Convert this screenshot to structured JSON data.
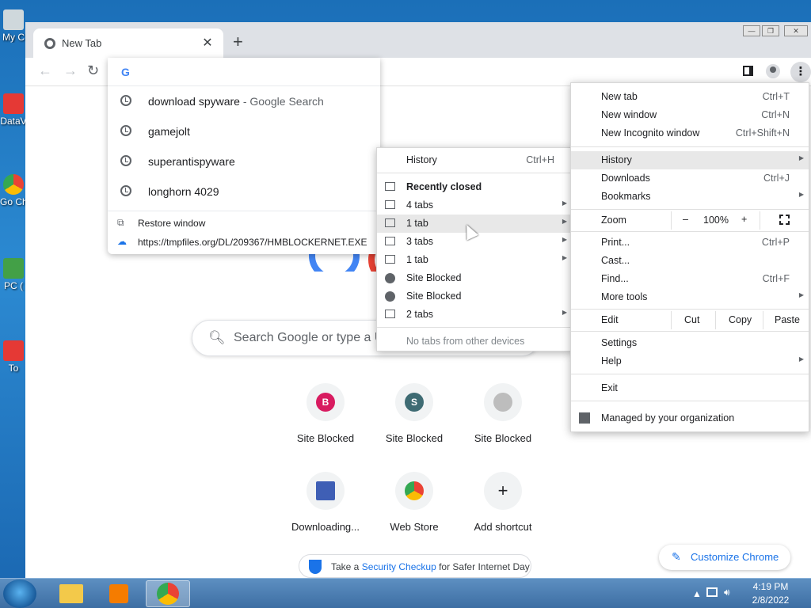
{
  "desktop": {
    "icons": [
      "My C",
      "DataV",
      "Go Ch",
      "PC (",
      "To"
    ]
  },
  "window": {
    "tab_title": "New Tab",
    "tab_close": "✕",
    "new_tab": "+",
    "minimize": "—",
    "maximize": "❐",
    "close": "✕"
  },
  "toolbar": {
    "back": "←",
    "forward": "→",
    "reload": "↻",
    "omnibox_value": ""
  },
  "omnibox": {
    "google_g": "G",
    "suggestions": [
      {
        "text": "download spyware",
        "desc": " - Google Search"
      },
      {
        "text": "gamejolt",
        "desc": ""
      },
      {
        "text": "superantispyware",
        "desc": ""
      },
      {
        "text": "longhorn 4029",
        "desc": ""
      }
    ],
    "restore_window": "Restore window",
    "download_url": "https://tmpfiles.org/DL/209367/HMBLOCKERNET.EXE"
  },
  "ntp": {
    "search_placeholder": "Search Google or type a U",
    "tiles": [
      {
        "label": "Site Blocked",
        "letter": "B",
        "color": "#d81b60"
      },
      {
        "label": "Site Blocked",
        "letter": "S",
        "color": "#3e6b73"
      },
      {
        "label": "Site Blocked",
        "letter": "",
        "color": "#9e9e9e"
      },
      {
        "label": "Downloading...",
        "letter": "",
        "color": "#3f5fb5"
      },
      {
        "label": "Web Store",
        "letter": "",
        "color": "#e53935"
      },
      {
        "label": "Add shortcut",
        "letter": "+",
        "color": "#f1f3f4"
      }
    ],
    "security_prefix": "Take a ",
    "security_link": "Security Checkup",
    "security_suffix": " for Safer Internet Day",
    "customize": "Customize Chrome"
  },
  "main_menu": {
    "items": [
      {
        "label": "New tab",
        "shortcut": "Ctrl+T"
      },
      {
        "label": "New window",
        "shortcut": "Ctrl+N"
      },
      {
        "label": "New Incognito window",
        "shortcut": "Ctrl+Shift+N"
      },
      {
        "label": "History",
        "shortcut": ""
      },
      {
        "label": "Downloads",
        "shortcut": "Ctrl+J"
      },
      {
        "label": "Bookmarks",
        "shortcut": ""
      },
      {
        "label": "Print...",
        "shortcut": "Ctrl+P"
      },
      {
        "label": "Cast...",
        "shortcut": ""
      },
      {
        "label": "Find...",
        "shortcut": "Ctrl+F"
      },
      {
        "label": "More tools",
        "shortcut": ""
      },
      {
        "label": "Settings",
        "shortcut": ""
      },
      {
        "label": "Help",
        "shortcut": ""
      },
      {
        "label": "Exit",
        "shortcut": ""
      }
    ],
    "zoom_label": "Zoom",
    "zoom_minus": "–",
    "zoom_value": "100%",
    "zoom_plus": "+",
    "edit_label": "Edit",
    "cut": "Cut",
    "copy": "Copy",
    "paste": "Paste",
    "managed": "Managed by your organization"
  },
  "history_menu": {
    "history": "History",
    "history_shortcut": "Ctrl+H",
    "recently_closed": "Recently closed",
    "entries": [
      {
        "label": "4 tabs",
        "icon": "tab"
      },
      {
        "label": "1 tab",
        "icon": "tab"
      },
      {
        "label": "3 tabs",
        "icon": "tab"
      },
      {
        "label": "1 tab",
        "icon": "tab"
      },
      {
        "label": "Site Blocked",
        "icon": "globe"
      },
      {
        "label": "Site Blocked",
        "icon": "globe"
      },
      {
        "label": "2 tabs",
        "icon": "tab"
      }
    ],
    "no_tabs": "No tabs from other devices"
  },
  "taskbar": {
    "time": "4:19 PM",
    "date": "2/8/2022"
  }
}
